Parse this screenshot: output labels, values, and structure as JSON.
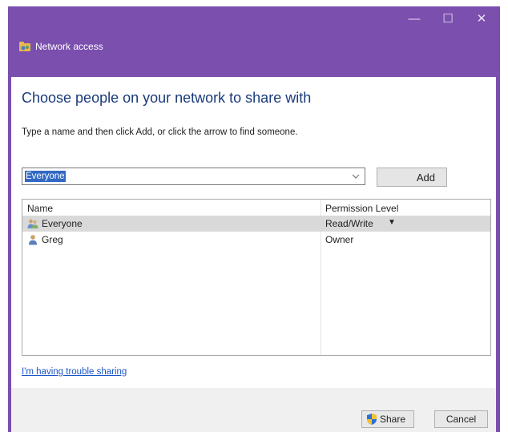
{
  "window": {
    "title": "Network access",
    "minimize_glyph": "—",
    "maximize_glyph": "☐",
    "close_glyph": "✕",
    "accent_color": "#7a4fae"
  },
  "main": {
    "heading": "Choose people on your network to share with",
    "instructions": "Type a name and then click Add, or click the arrow to find someone.",
    "name_combo": {
      "value": "Everyone"
    },
    "add_label": "Add"
  },
  "list": {
    "columns": [
      "Name",
      "Permission Level"
    ],
    "rows": [
      {
        "name": "Everyone",
        "permission": "Read/Write",
        "icon": "group-users-icon",
        "selected": true
      },
      {
        "name": "Greg",
        "permission": "Owner",
        "icon": "user-icon",
        "selected": false
      }
    ],
    "perm_arrow_glyph": "▼"
  },
  "help_link": "I'm having trouble sharing",
  "footer": {
    "share_label": "Share",
    "cancel_label": "Cancel"
  }
}
